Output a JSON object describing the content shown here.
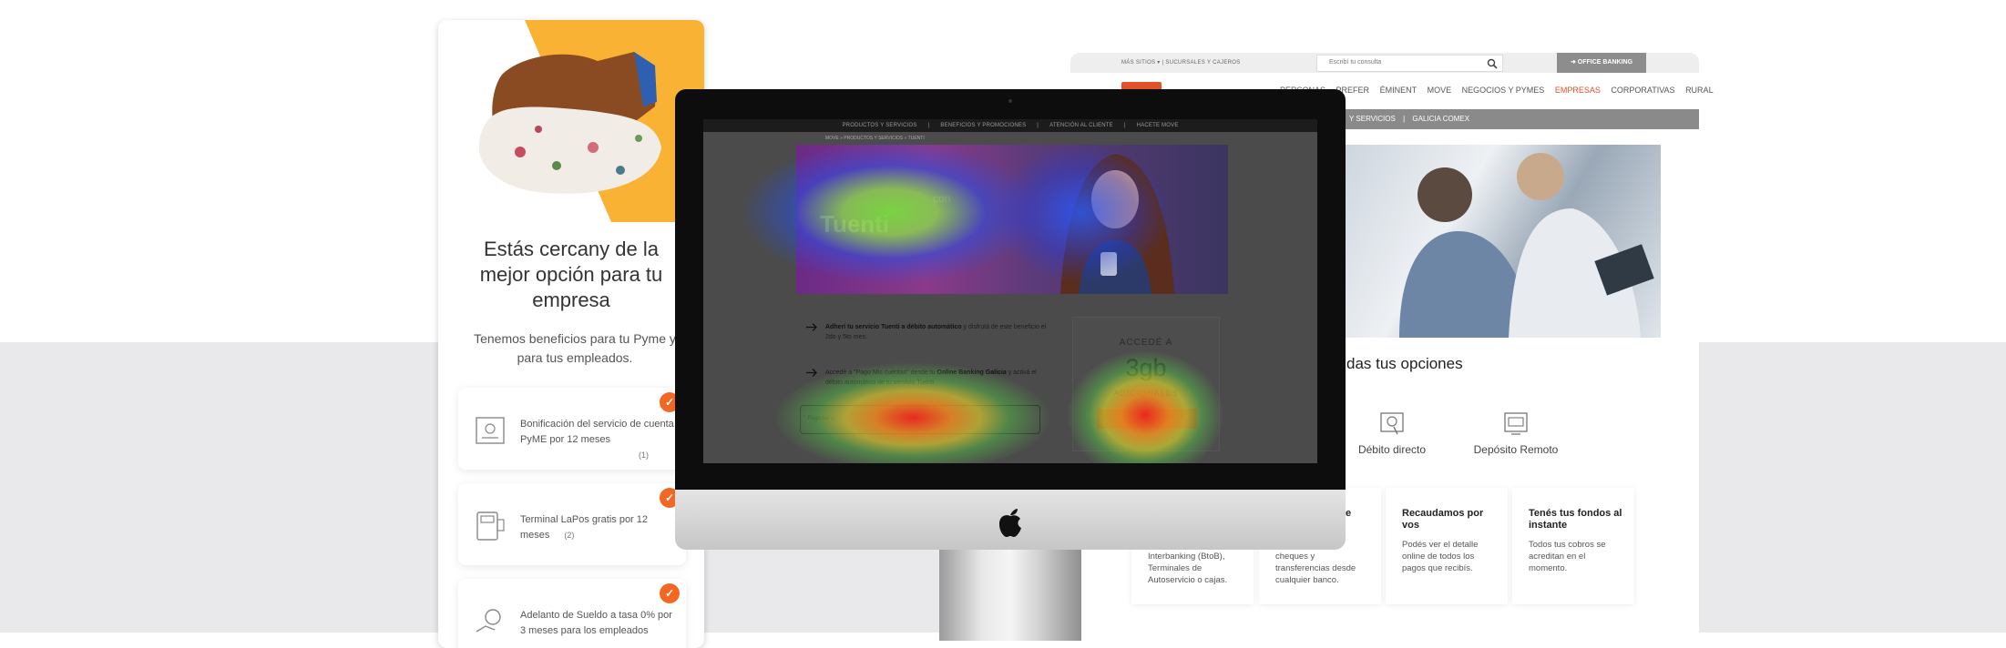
{
  "mobile": {
    "headline": "Estás cercany de la mejor opción para tu empresa",
    "subtitle": "Tenemos beneficios para tu Pyme y para tus empleados.",
    "benefits": [
      {
        "text": "Bonificación del servicio de cuenta PyME por 12 meses",
        "note": "(1)"
      },
      {
        "text": "Terminal LaPos gratis por 12 meses",
        "note": "(2)"
      },
      {
        "text": "Adelanto de Sueldo a tasa 0% por 3 meses para los empleados",
        "note": ""
      }
    ],
    "check_glyph": "✓"
  },
  "site": {
    "top_links": "MÁS SITIOS  ▾  |  SUCURSALES Y CAJEROS",
    "search_placeholder": "Escribí tu consulta",
    "office_banking": "OFFICE BANKING",
    "main_nav": [
      "PERSONAS",
      "PREFER",
      "ÉMINENT",
      "MOVE",
      "NEGOCIOS Y PYMES",
      "EMPRESAS",
      "CORPORATIVAS",
      "RURAL"
    ],
    "active_nav": "EMPRESAS",
    "sub_nav": [
      "Y SERVICIOS",
      "|",
      "GALICIA COMEX"
    ],
    "section_title": "das tus opciones",
    "services": [
      "Débito directo",
      "Depósito Remoto"
    ],
    "feature_cards": [
      {
        "title": "",
        "desc": "Interbanking (BtoB), Terminales de Autoservicio o cajas."
      },
      {
        "title": "e",
        "desc": "cheques y transferencias desde cualquier banco."
      },
      {
        "title": "Recaudamos por vos",
        "desc": "Podés ver el detalle online de todos los pagos que recibís."
      },
      {
        "title": "Tenés tus fondos al instante",
        "desc": "Todos tus cobros se acreditan en el momento."
      }
    ],
    "accent": "#e2522a"
  },
  "imac_screen": {
    "nav": [
      "PRODUCTOS Y SERVICIOS",
      "|",
      "BENEFICIOS Y PROMOCIONES",
      "|",
      "ATENCIÓN AL CLIENTE",
      "|",
      "HACETE MOVE"
    ],
    "breadcrumb": "MOVE  »  PRODUCTOS Y SERVICIOS  »  TUENTI",
    "banner_small": "con",
    "banner_word": "Tuenti",
    "row1_bold": "Adherí tu servicio Tuenti a débito automático",
    "row1_rest": " y disfrutá de este beneficio el 2do y 5to mes.",
    "row2_pre": "Accedé a \"Pago Mis cuentas\" desde tu ",
    "row2_bold": "Online Banking Galicia",
    "row2_rest": " y activá el débito automático de tu servicio Tuenti.",
    "input_placeholder": "Pago tus c",
    "promo_line1": "ACCEDÉ A",
    "promo_line2": "3gb",
    "promo_line3": "ADICIONALES"
  }
}
